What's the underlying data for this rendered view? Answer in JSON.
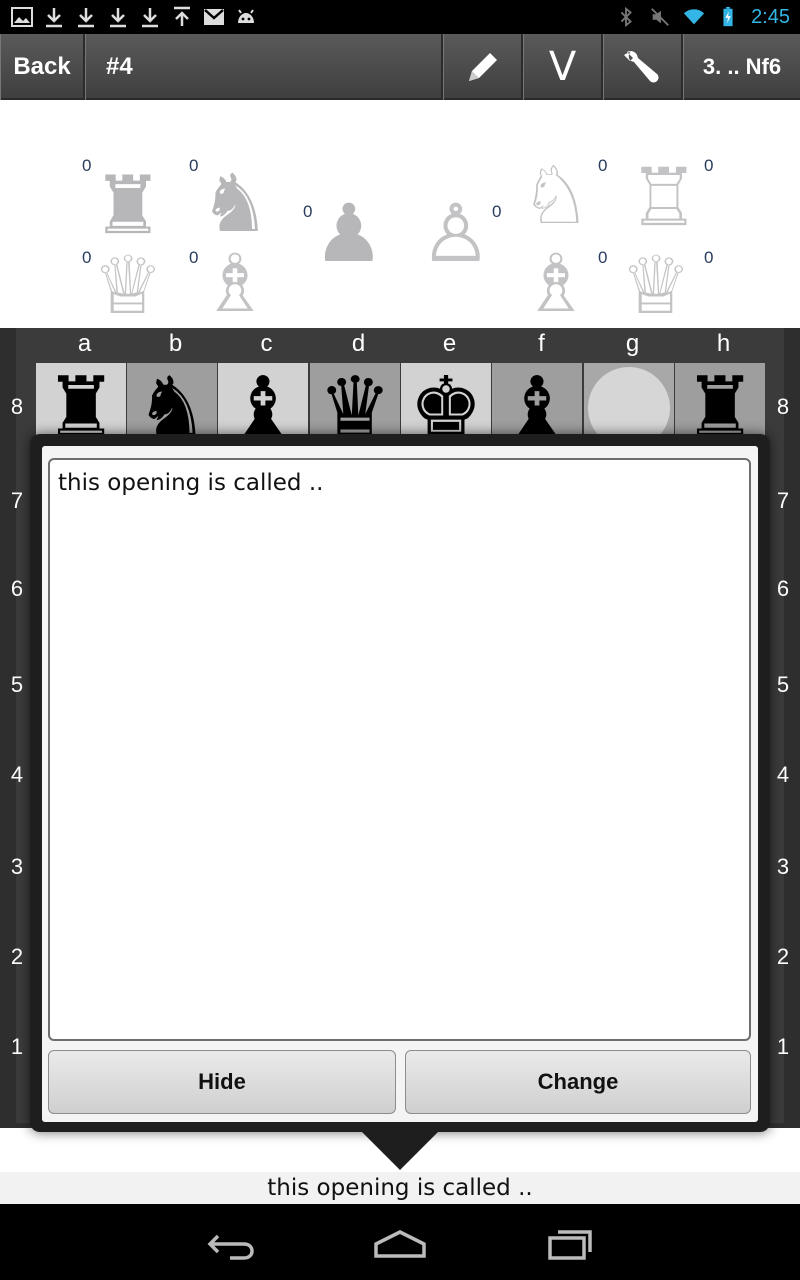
{
  "status_bar": {
    "time": "2:45",
    "left_icons": [
      "image-icon",
      "download-icon",
      "download-icon",
      "download-icon",
      "download-icon",
      "upload-icon",
      "gmail-icon",
      "android-icon"
    ],
    "right_icons": [
      "bluetooth-icon",
      "mute-icon",
      "wifi-icon",
      "battery-icon"
    ],
    "accent": "#33b5e5"
  },
  "toolbar": {
    "back_label": "Back",
    "title": "#4",
    "v_label": "V",
    "move_label": "3. .. Nf6",
    "edit_icon": "pencil-icon",
    "tools_icon": "wrench-icon"
  },
  "captured": {
    "black": [
      {
        "piece": "rook",
        "count": "0"
      },
      {
        "piece": "knight",
        "count": "0"
      },
      {
        "piece": "queen",
        "count": "0"
      },
      {
        "piece": "bishop",
        "count": "0"
      },
      {
        "piece": "pawn",
        "count": "0"
      }
    ],
    "white": [
      {
        "piece": "pawn",
        "count": "0"
      },
      {
        "piece": "knight",
        "count": "0"
      },
      {
        "piece": "rook",
        "count": "0"
      },
      {
        "piece": "bishop",
        "count": "0"
      },
      {
        "piece": "queen",
        "count": "0"
      }
    ]
  },
  "board": {
    "files": [
      "a",
      "b",
      "c",
      "d",
      "e",
      "f",
      "g",
      "h"
    ],
    "ranks": [
      "8",
      "7",
      "6",
      "5",
      "4",
      "3",
      "2",
      "1"
    ],
    "rank8": [
      "♜",
      "♞",
      "♝",
      "♛",
      "♚",
      "♝",
      "",
      "♜"
    ],
    "light_color": "#d2d2d2",
    "dark_color": "#9e9e9e"
  },
  "dialog": {
    "comment": "this opening is called ..",
    "hide_label": "Hide",
    "change_label": "Change"
  },
  "comment_line": {
    "text": "this opening is called .."
  },
  "nav_bar": {
    "icons": [
      "back-nav-icon",
      "home-nav-icon",
      "recents-nav-icon"
    ]
  }
}
